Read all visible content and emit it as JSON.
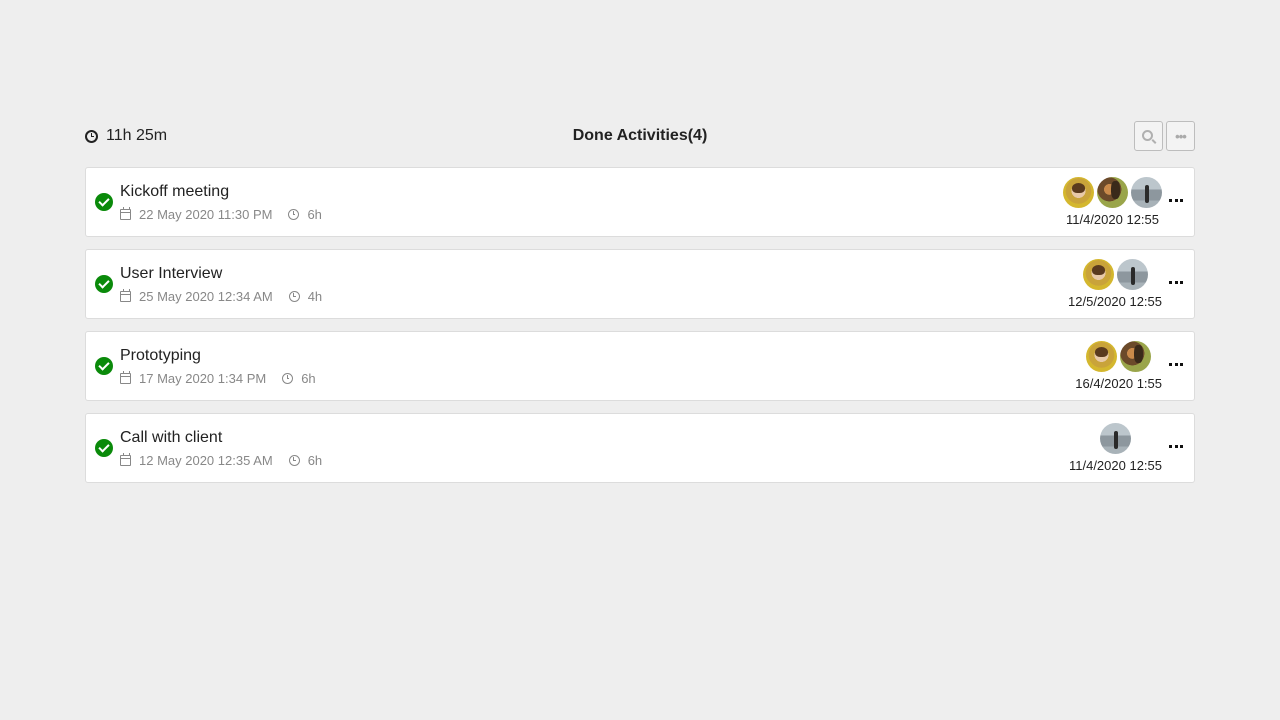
{
  "header": {
    "total_time": "11h 25m",
    "title": "Done Activities(4)"
  },
  "activities": [
    {
      "name": "Kickoff meeting",
      "date": "22 May 2020 11:30 PM",
      "duration": "6h",
      "avatars": [
        "avatar-yellow",
        "avatar-dark",
        "avatar-grey"
      ],
      "updated": "11/4/2020 12:55"
    },
    {
      "name": "User Interview",
      "date": "25 May 2020 12:34 AM",
      "duration": "4h",
      "avatars": [
        "avatar-yellow",
        "avatar-grey"
      ],
      "updated": "12/5/2020 12:55"
    },
    {
      "name": "Prototyping",
      "date": "17 May 2020 1:34 PM",
      "duration": "6h",
      "avatars": [
        "avatar-yellow",
        "avatar-dark"
      ],
      "updated": "16/4/2020 1:55"
    },
    {
      "name": "Call with client",
      "date": "12 May 2020 12:35 AM",
      "duration": "6h",
      "avatars": [
        "avatar-grey"
      ],
      "updated": "11/4/2020 12:55"
    }
  ],
  "colors": {
    "background": "#eeeeee",
    "done_check": "#0a8a0a",
    "card": "#ffffff"
  }
}
